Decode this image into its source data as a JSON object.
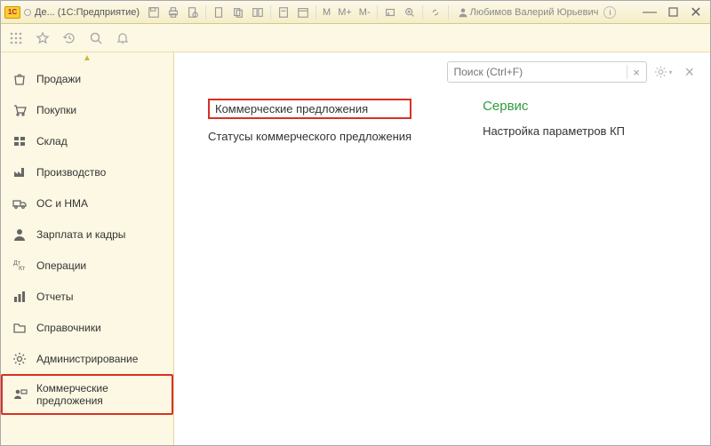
{
  "titlebar": {
    "logo_text": "1C",
    "title": "Де...  (1С:Предприятие)",
    "m_items": [
      "M",
      "M+",
      "M-"
    ],
    "user": "Любимов Валерий Юрьевич",
    "badge": "i"
  },
  "search": {
    "placeholder": "Поиск (Ctrl+F)"
  },
  "sidebar": {
    "items": [
      {
        "label": "Продажи"
      },
      {
        "label": "Покупки"
      },
      {
        "label": "Склад"
      },
      {
        "label": "Производство"
      },
      {
        "label": "ОС и НМА"
      },
      {
        "label": "Зарплата и кадры"
      },
      {
        "label": "Операции"
      },
      {
        "label": "Отчеты"
      },
      {
        "label": "Справочники"
      },
      {
        "label": "Администрирование"
      },
      {
        "label": "Коммерческие предложения"
      }
    ]
  },
  "main": {
    "col1": {
      "link1": "Коммерческие предложения",
      "link2": "Статусы коммерческого предложения"
    },
    "col2": {
      "heading": "Сервис",
      "link1": "Настройка параметров КП"
    }
  }
}
